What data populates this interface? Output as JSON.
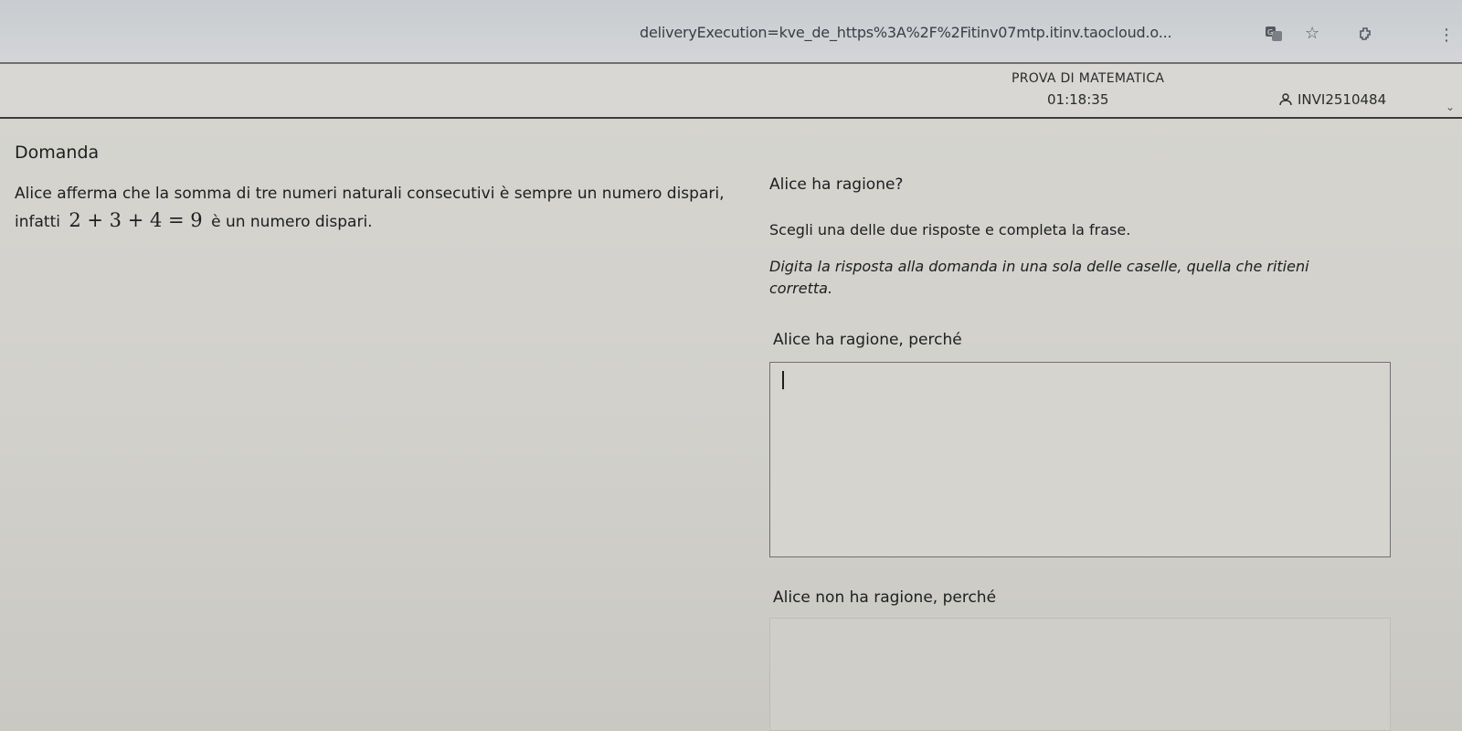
{
  "browser": {
    "url": "deliveryExecution=kve_de_https%3A%2F%2Fitinv07mtp.itinv.taocloud.o...",
    "icons": [
      "translate-icon",
      "star-icon",
      "extension-icon",
      "more-menu-icon"
    ]
  },
  "header": {
    "test_title": "PROVA DI MATEMATICA",
    "timer": "01:18:35",
    "user_code": "INVI2510484"
  },
  "question": {
    "section_label": "Domanda",
    "stimulus_text_1": "Alice afferma che la somma di tre numeri naturali consecutivi è sempre un numero dispari, infatti",
    "math_expression": "2 + 3 + 4 = 9",
    "stimulus_text_2": "è un numero dispari.",
    "prompt": "Alice ha ragione?",
    "instruction_1": "Scegli una delle due risposte e completa la frase.",
    "instruction_2": "Digita la risposta alla domanda in una sola delle caselle, quella che ritieni corretta.",
    "options": [
      {
        "label": "Alice ha ragione, perché",
        "value": ""
      },
      {
        "label": "Alice non ha ragione, perché",
        "value": ""
      }
    ]
  },
  "colors": {
    "background": "#d4d3ce",
    "text": "#1d1e1f",
    "border": "#6f7174"
  }
}
